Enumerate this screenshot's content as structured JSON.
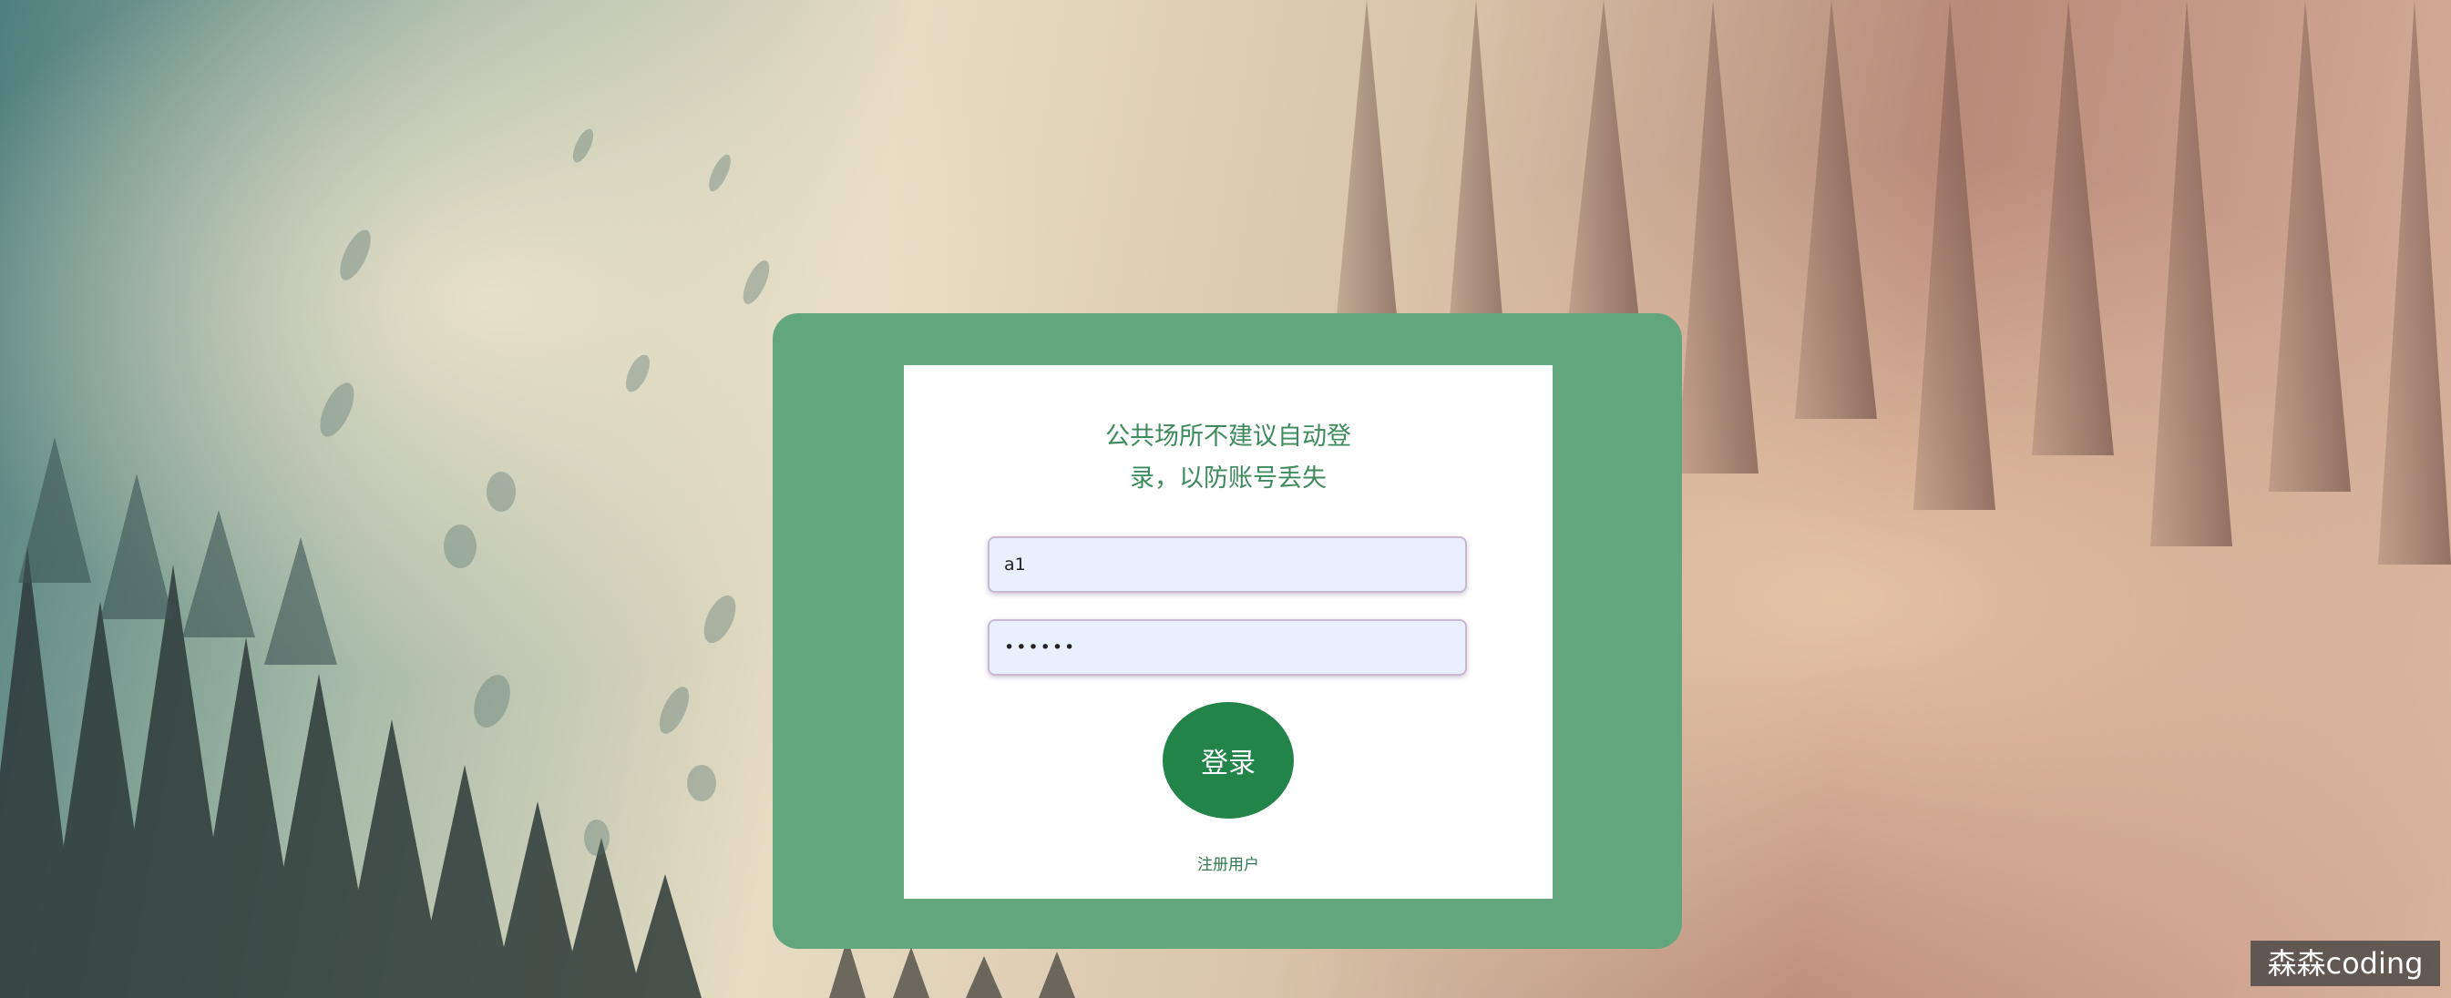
{
  "login": {
    "notice_line1": "公共场所不建议自动登",
    "notice_line2": "录，以防账号丢失",
    "username_value": "a1",
    "password_value": "••••••",
    "login_label": "登录",
    "register_label": "注册用户"
  },
  "watermark": {
    "text": "森森coding"
  },
  "colors": {
    "card_green": "#62a67d",
    "button_green": "#228449",
    "notice_text": "#3d8a5c",
    "input_bg": "#e8f0fe"
  }
}
